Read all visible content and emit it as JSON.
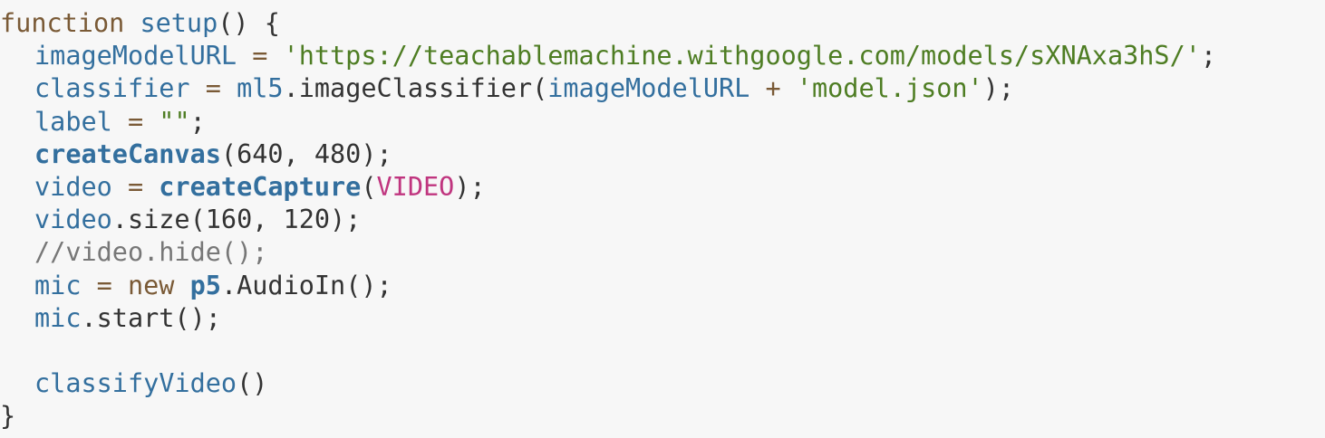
{
  "editor": {
    "lines": [
      [
        {
          "t": "function",
          "c": "keyword"
        },
        {
          "t": " ",
          "c": "plain"
        },
        {
          "t": "setup",
          "c": "func"
        },
        {
          "t": "() {",
          "c": "plain"
        }
      ],
      [
        {
          "t": "imageModelURL",
          "c": "var"
        },
        {
          "t": " = ",
          "c": "op"
        },
        {
          "t": "'https://teachablemachine.withgoogle.com/models/sXNAxa3hS/'",
          "c": "string"
        },
        {
          "t": ";",
          "c": "plain"
        }
      ],
      [
        {
          "t": "classifier",
          "c": "var"
        },
        {
          "t": " = ",
          "c": "op"
        },
        {
          "t": "ml5",
          "c": "var"
        },
        {
          "t": ".imageClassifier(",
          "c": "plain"
        },
        {
          "t": "imageModelURL",
          "c": "var"
        },
        {
          "t": " + ",
          "c": "op"
        },
        {
          "t": "'model.json'",
          "c": "string"
        },
        {
          "t": ");",
          "c": "plain"
        }
      ],
      [
        {
          "t": "label",
          "c": "var"
        },
        {
          "t": " = ",
          "c": "op"
        },
        {
          "t": "\"\"",
          "c": "string"
        },
        {
          "t": ";",
          "c": "plain"
        }
      ],
      [
        {
          "t": "createCanvas",
          "c": "func-bold"
        },
        {
          "t": "(640, 480);",
          "c": "plain"
        }
      ],
      [
        {
          "t": "video",
          "c": "var"
        },
        {
          "t": " = ",
          "c": "op"
        },
        {
          "t": "createCapture",
          "c": "func-bold"
        },
        {
          "t": "(",
          "c": "plain"
        },
        {
          "t": "VIDEO",
          "c": "const"
        },
        {
          "t": ");",
          "c": "plain"
        }
      ],
      [
        {
          "t": "video",
          "c": "var"
        },
        {
          "t": ".size(160, 120);",
          "c": "plain"
        }
      ],
      [
        {
          "t": "//video.hide();",
          "c": "comment"
        }
      ],
      [
        {
          "t": "mic",
          "c": "var"
        },
        {
          "t": " = ",
          "c": "op"
        },
        {
          "t": "new",
          "c": "keyword"
        },
        {
          "t": " ",
          "c": "plain"
        },
        {
          "t": "p5",
          "c": "func-bold"
        },
        {
          "t": ".AudioIn();",
          "c": "plain"
        }
      ],
      [
        {
          "t": "mic",
          "c": "var"
        },
        {
          "t": ".start();",
          "c": "plain"
        }
      ],
      [],
      [
        {
          "t": "classifyVideo",
          "c": "func"
        },
        {
          "t": "()",
          "c": "plain"
        }
      ],
      [
        {
          "t": "}",
          "c": "plain"
        }
      ]
    ],
    "indents": [
      0,
      1,
      1,
      1,
      1,
      1,
      1,
      1,
      1,
      1,
      0,
      1,
      0
    ]
  }
}
